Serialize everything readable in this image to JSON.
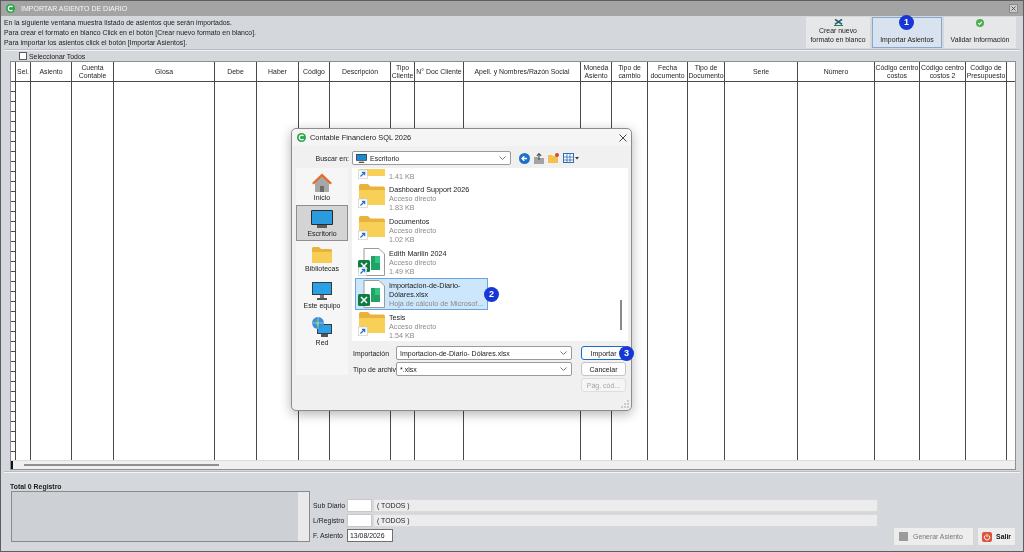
{
  "window": {
    "title": "IMPORTAR ASIENTO DE DIARIO"
  },
  "instructions": [
    "En la siguiente ventana muestra listado de asientos que serán importados.",
    "Para crear el formato en blanco Click en el botón  [Crear nuevo formato en blanco].",
    "Para importar los asientos click el botón  [Importar Asientos]."
  ],
  "toolbar": [
    {
      "kind": "excel",
      "label": "Crear nuevo formato en blanco",
      "selected": false
    },
    {
      "kind": "none",
      "label": "Importar Asientos",
      "selected": true,
      "badge": "1"
    },
    {
      "kind": "check",
      "label": "Validar Información",
      "selected": false
    }
  ],
  "select_all": {
    "label": "Seleccionar Todos",
    "checked": false
  },
  "table": {
    "columns": [
      "Sel.",
      "Asiento",
      "Cuenta Contable",
      "Glosa",
      "Debe",
      "Haber",
      "Código",
      "Descripción",
      "Tipo Cliente",
      "N° Doc Cliente",
      "Apell. y Nombres/Razón Social",
      "Moneda Asiento",
      "Tipo de cambio",
      "Fecha documento",
      "Tipo de Documento",
      "Serie",
      "Número",
      "Código centro costos",
      "Código centro costos 2",
      "Código de Presupuesto"
    ]
  },
  "summary": {
    "total": "Total 0 Registro"
  },
  "filters": [
    {
      "kind": "lookup",
      "label": "Sub Diario",
      "value": "( TODOS )"
    },
    {
      "kind": "lookup",
      "label": "L/Registro",
      "value": "( TODOS )"
    },
    {
      "kind": "date",
      "label": "F. Asiento",
      "value": "13/08/2026"
    }
  ],
  "actions": [
    {
      "kind": "generate",
      "label": "Generar Asiento",
      "disabled": true
    },
    {
      "kind": "exit",
      "label": "Salir",
      "disabled": false
    }
  ],
  "dialog": {
    "title": "Contable Financiero SQL 2026",
    "look_in": {
      "label": "Buscar en:",
      "value": "Escritorio"
    },
    "places": [
      {
        "kind": "home",
        "label": "Inicio",
        "selected": false
      },
      {
        "kind": "desktop",
        "label": "Escritorio",
        "selected": true
      },
      {
        "kind": "libraries",
        "label": "Bibliotecas",
        "selected": false
      },
      {
        "kind": "computer",
        "label": "Este equipo",
        "selected": false
      },
      {
        "kind": "network",
        "label": "Red",
        "selected": false
      }
    ],
    "files": [
      {
        "kind": "folder-shortcut",
        "details": [
          "1.41 KB"
        ],
        "clipped": true,
        "selected": false
      },
      {
        "kind": "folder-shortcut",
        "name": "Dashboard Support 2026",
        "details": [
          "Acceso directo",
          "1.83 KB"
        ],
        "clipped": false,
        "selected": false
      },
      {
        "kind": "folder-shortcut",
        "name": "Documentos",
        "details": [
          "Acceso directo",
          "1.02 KB"
        ],
        "clipped": false,
        "selected": false
      },
      {
        "kind": "excel-shortcut",
        "name": "Edith Marilin 2024",
        "details": [
          "Acceso directo",
          "1.49 KB"
        ],
        "clipped": false,
        "selected": false
      },
      {
        "kind": "excel",
        "name": "Importacion-de-Diario-Dólares.xlsx",
        "details": [
          "Hoja de cálculo de Microsof..."
        ],
        "clipped": false,
        "selected": true,
        "badge": "2"
      },
      {
        "kind": "folder-shortcut",
        "name": "Tesis",
        "details": [
          "Acceso directo",
          "1.54 KB"
        ],
        "clipped": false,
        "selected": false
      }
    ],
    "fields": [
      {
        "label": "Importación",
        "value": "Importacion-de-Diario- Dólares.xlsx"
      },
      {
        "label": "Tipo de archiv",
        "value": "*.xlsx"
      }
    ],
    "buttons": [
      {
        "label": "Importar",
        "default": true,
        "disabled": false,
        "badge": "3"
      },
      {
        "label": "Cancelar",
        "default": false,
        "disabled": false
      },
      {
        "label": "Pág. cód...",
        "default": false,
        "disabled": true
      }
    ]
  }
}
